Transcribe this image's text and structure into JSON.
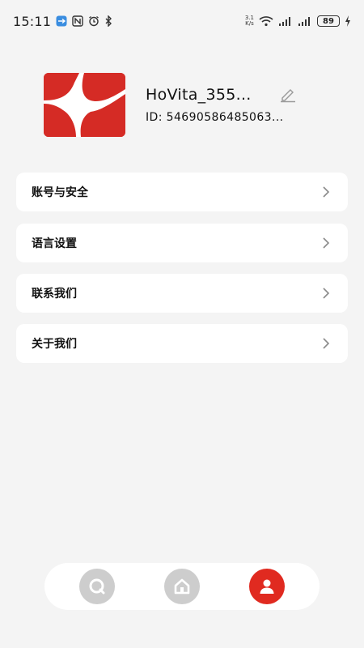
{
  "status_bar": {
    "time": "15:11",
    "net_speed_value": "3.1",
    "net_speed_unit": "K/s",
    "battery": "89",
    "icons": [
      "app-notification-icon",
      "nfc-icon",
      "alarm-icon",
      "bluetooth-icon",
      "wifi-icon",
      "signal-icon",
      "signal-icon",
      "charging-icon"
    ]
  },
  "profile": {
    "username": "HoVita_355...",
    "id_text": "ID: 54690586485063..."
  },
  "menu": [
    {
      "label": "账号与安全"
    },
    {
      "label": "语言设置"
    },
    {
      "label": "联系我们"
    },
    {
      "label": "关于我们"
    }
  ],
  "bottom_nav": {
    "items": [
      {
        "icon": "search-chat-icon",
        "active": false
      },
      {
        "icon": "home-icon",
        "active": false
      },
      {
        "icon": "profile-icon",
        "active": true
      }
    ]
  },
  "colors": {
    "accent": "#e02a20",
    "inactive_icon": "#cdcdcd",
    "background": "#f4f4f4",
    "card": "#ffffff"
  }
}
